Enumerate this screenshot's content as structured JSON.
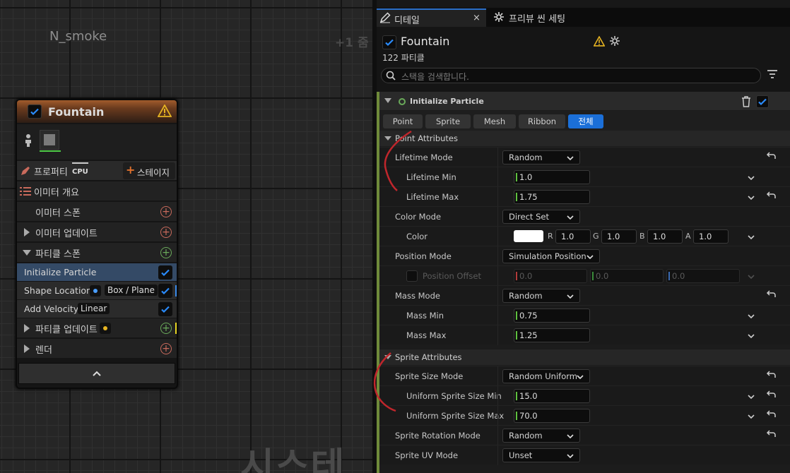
{
  "graph": {
    "title": "N_smoke",
    "zoom": "+1 줌",
    "watermark": "시스테"
  },
  "node": {
    "title": "Fountain",
    "properties_label": "프로퍼티",
    "cpu_label": "CPU",
    "stage_label": "스테이지",
    "emitter_summary": "이미터 개요",
    "emitter_spawn": "이미터 스폰",
    "emitter_update": "이미터 업데이트",
    "particle_spawn": "파티클 스폰",
    "modules": [
      {
        "label": "Initialize Particle",
        "tag": ""
      },
      {
        "label": "Shape Location",
        "tag": "Box / Plane"
      },
      {
        "label": "Add Velocity",
        "tag": "Linear"
      }
    ],
    "particle_update": "파티클 업데이트",
    "render": "렌더"
  },
  "panel": {
    "tab_details": "디테일",
    "tab_preview": "프리뷰 씬 세팅",
    "emitter_name": "Fountain",
    "particle_count": "122 파티클",
    "search_placeholder": "스택을 검색합니다.",
    "section_title": "Initialize Particle",
    "filters": [
      "Point",
      "Sprite",
      "Mesh",
      "Ribbon",
      "전체"
    ],
    "selected_filter": "전체",
    "point_attributes": "Point Attributes",
    "sprite_attributes": "Sprite Attributes",
    "props": {
      "lifetime_mode": {
        "label": "Lifetime Mode",
        "value": "Random"
      },
      "lifetime_min": {
        "label": "Lifetime Min",
        "value": "1.0"
      },
      "lifetime_max": {
        "label": "Lifetime Max",
        "value": "1.75"
      },
      "color_mode": {
        "label": "Color Mode",
        "value": "Direct Set"
      },
      "color": {
        "label": "Color",
        "r": "1.0",
        "g": "1.0",
        "b": "1.0",
        "a": "1.0",
        "r_label": "R",
        "g_label": "G",
        "b_label": "B",
        "a_label": "A"
      },
      "position_mode": {
        "label": "Position Mode",
        "value": "Simulation Position"
      },
      "position_offset": {
        "label": "Position Offset",
        "x": "0.0",
        "y": "0.0",
        "z": "0.0"
      },
      "mass_mode": {
        "label": "Mass Mode",
        "value": "Random"
      },
      "mass_min": {
        "label": "Mass Min",
        "value": "0.75"
      },
      "mass_max": {
        "label": "Mass Max",
        "value": "1.25"
      },
      "sprite_size_mode": {
        "label": "Sprite Size Mode",
        "value": "Random Uniform"
      },
      "uniform_min": {
        "label": "Uniform Sprite Size Min",
        "value": "15.0"
      },
      "uniform_max": {
        "label": "Uniform Sprite Size Max",
        "value": "70.0"
      },
      "sprite_rotation_mode": {
        "label": "Sprite Rotation Mode",
        "value": "Random"
      },
      "sprite_uv_mode": {
        "label": "Sprite UV Mode",
        "value": "Unset"
      }
    }
  },
  "colors": {
    "accent": "#1b6fd8",
    "warning": "#e6b422",
    "annotation": "#c0262c"
  }
}
